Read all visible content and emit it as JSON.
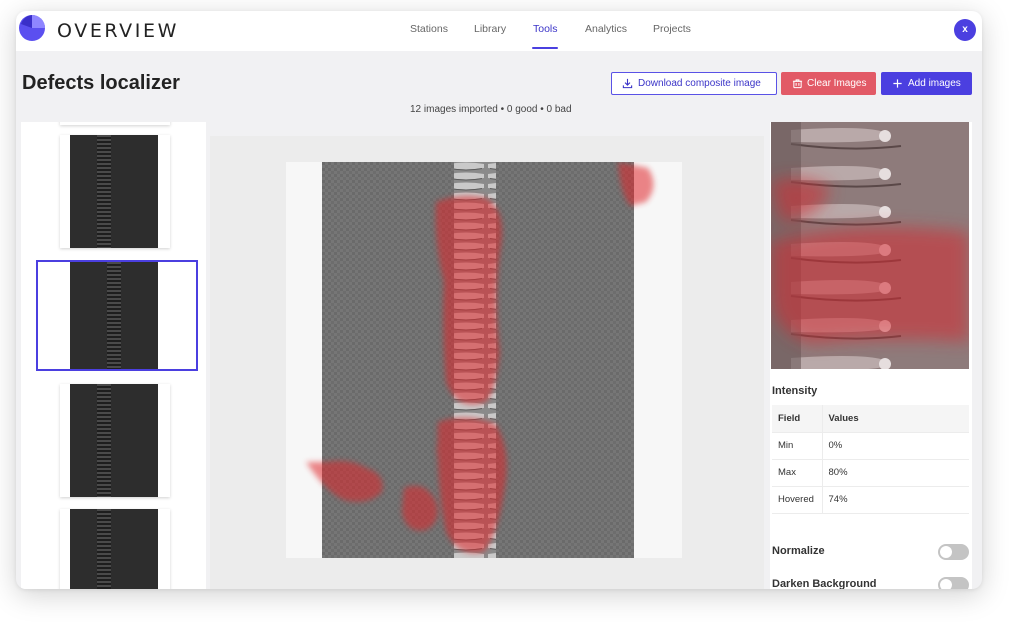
{
  "app": {
    "brand": "OVERVIEW",
    "user_initial": "x"
  },
  "nav": {
    "items": [
      {
        "label": "Stations",
        "active": false
      },
      {
        "label": "Library",
        "active": false
      },
      {
        "label": "Tools",
        "active": true
      },
      {
        "label": "Analytics",
        "active": false
      },
      {
        "label": "Projects",
        "active": false
      }
    ]
  },
  "page": {
    "title": "Defects localizer",
    "summary": "12 images imported • 0 good • 0 bad"
  },
  "toolbar": {
    "download_label": "Download composite image",
    "clear_label": "Clear Images",
    "add_label": "Add images",
    "download_icon": "download-icon",
    "clear_icon": "trash-icon",
    "add_icon": "plus-icon"
  },
  "thumbnails": {
    "count_visible": 4,
    "selected_index": 1
  },
  "intensity": {
    "title": "Intensity",
    "headers": [
      "Field",
      "Values"
    ],
    "rows": [
      {
        "field": "Min",
        "value": "0%"
      },
      {
        "field": "Max",
        "value": "80%"
      },
      {
        "field": "Hovered",
        "value": "74%"
      }
    ]
  },
  "options": {
    "normalize": {
      "label": "Normalize",
      "on": false
    },
    "darken_background": {
      "label": "Darken Background",
      "on": false
    }
  },
  "colors": {
    "accent": "#4b3fe0",
    "danger": "#e25a66",
    "heatmap": "#e0262c"
  }
}
